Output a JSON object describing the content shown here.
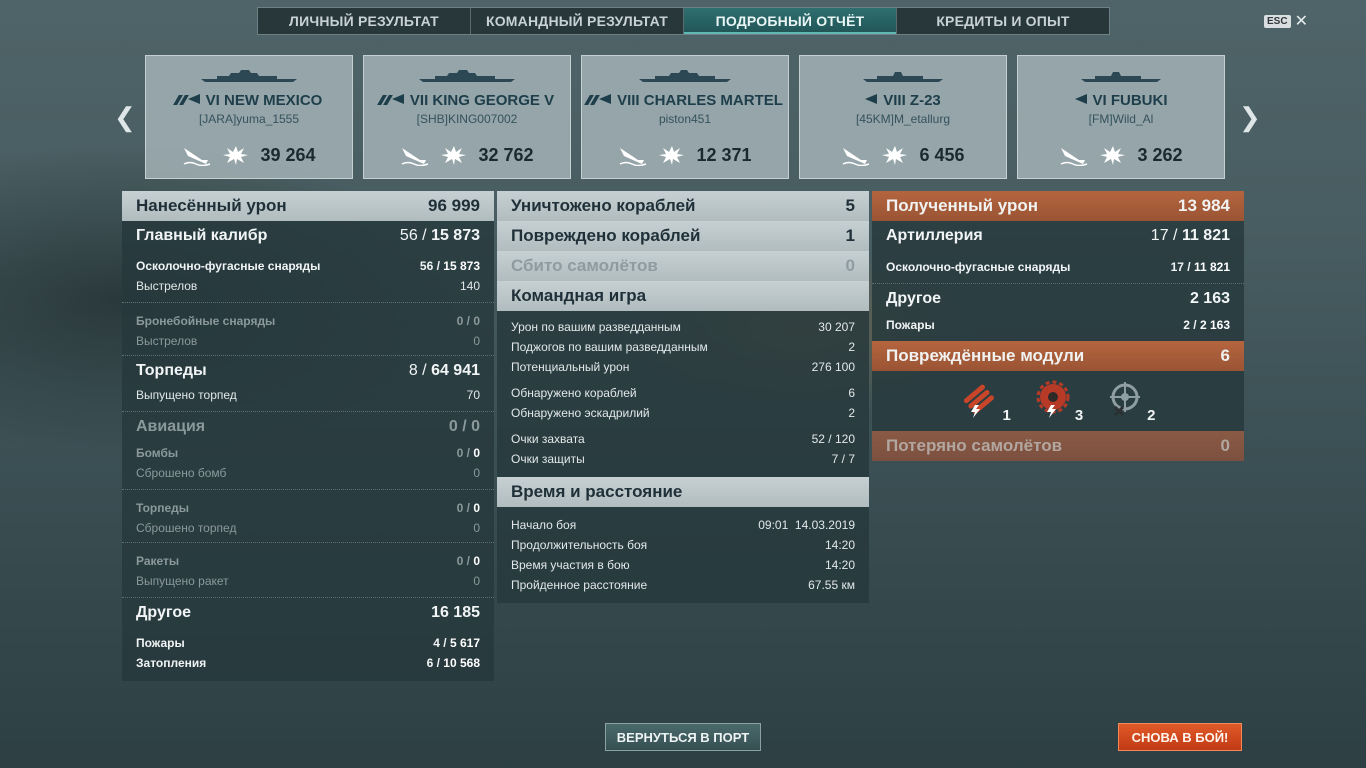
{
  "tabs": [
    "ЛИЧНЫЙ РЕЗУЛЬТАТ",
    "КОМАНДНЫЙ РЕЗУЛЬТАТ",
    "ПОДРОБНЫЙ ОТЧЁТ",
    "КРЕДИТЫ И ОПЫТ"
  ],
  "active_tab": "ПОДРОБНЫЙ ОТЧЁТ",
  "esc_label": "ESC",
  "close_glyph": "✕",
  "arrows": {
    "left": "❮",
    "right": "❯"
  },
  "ships": [
    {
      "tier_name": "VI NEW MEXICO",
      "player": "[JARA]yuma_1555",
      "damage": "39 264",
      "type": "battleship"
    },
    {
      "tier_name": "VII KING GEORGE V",
      "player": "[SHB]KING007002",
      "damage": "32 762",
      "type": "battleship"
    },
    {
      "tier_name": "VIII CHARLES MARTEL",
      "player": "piston451",
      "damage": "12 371",
      "type": "cruiser"
    },
    {
      "tier_name": "VIII Z-23",
      "player": "[45KM]M_etallurg",
      "damage": "6 456",
      "type": "destroyer"
    },
    {
      "tier_name": "VI FUBUKI",
      "player": "[FM]Wild_Al",
      "damage": "3 262",
      "type": "destroyer"
    }
  ],
  "left": {
    "dealt": {
      "label": "Нанесённый урон",
      "value": "96 999"
    },
    "main_battery": {
      "label": "Главный калибр",
      "hits": "56",
      "damage": "15 873"
    },
    "he": {
      "label": "Осколочно-фугасные снаряды",
      "hits": "56",
      "damage": "15 873"
    },
    "he_shots": {
      "label": "Выстрелов",
      "value": "140"
    },
    "ap": {
      "label": "Бронебойные снаряды",
      "value": "0 / 0"
    },
    "ap_shots": {
      "label": "Выстрелов",
      "value": "0"
    },
    "torpedoes": {
      "label": "Торпеды",
      "hits": "8",
      "damage": "64 941"
    },
    "torp_fired": {
      "label": "Выпущено торпед",
      "value": "70"
    },
    "aviation": {
      "label": "Авиация",
      "value": "0 / 0"
    },
    "bombs": {
      "label": "Бомбы",
      "hits": "0",
      "damage": "0"
    },
    "bombs_dropped": {
      "label": "Сброшено бомб",
      "value": "0"
    },
    "air_torps": {
      "label": "Торпеды",
      "hits": "0",
      "damage": "0"
    },
    "air_torps_dropped": {
      "label": "Сброшено торпед",
      "value": "0"
    },
    "rockets": {
      "label": "Ракеты",
      "hits": "0",
      "damage": "0"
    },
    "rockets_fired": {
      "label": "Выпущено ракет",
      "value": "0"
    },
    "other": {
      "label": "Другое",
      "value": "16 185"
    },
    "fires": {
      "label": "Пожары",
      "hits": "4",
      "damage": "5 617"
    },
    "floods": {
      "label": "Затопления",
      "hits": "6",
      "damage": "10 568"
    }
  },
  "middle": {
    "destroyed": {
      "label": "Уничтожено кораблей",
      "value": "5"
    },
    "damaged": {
      "label": "Повреждено кораблей",
      "value": "1"
    },
    "planes": {
      "label": "Сбито самолётов",
      "value": "0"
    },
    "team": {
      "label": "Командная игра"
    },
    "team_rows": [
      {
        "label": "Урон по вашим разведданным",
        "value": "30 207"
      },
      {
        "label": "Поджогов по вашим разведданным",
        "value": "2"
      },
      {
        "label": "Потенциальный урон",
        "value": "276 100"
      },
      {
        "label": "Обнаружено кораблей",
        "value": "6"
      },
      {
        "label": "Обнаружено эскадрилий",
        "value": "2"
      },
      {
        "label": "Очки захвата",
        "value": "52 / 120"
      },
      {
        "label": "Очки защиты",
        "value": "7 / 7"
      }
    ],
    "time": {
      "label": "Время и расстояние"
    },
    "time_rows": [
      {
        "label": "Начало боя",
        "value": "09:01  14.03.2019"
      },
      {
        "label": "Продолжительность боя",
        "value": "14:20"
      },
      {
        "label": "Время участия в бою",
        "value": "14:20"
      },
      {
        "label": "Пройденное расстояние",
        "value": "67.55 км"
      }
    ]
  },
  "right": {
    "received": {
      "label": "Полученный урон",
      "value": "13 984"
    },
    "artillery": {
      "label": "Артиллерия",
      "hits": "17",
      "damage": "11 821"
    },
    "he": {
      "label": "Осколочно-фугасные снаряды",
      "hits": "17",
      "damage": "11 821"
    },
    "other": {
      "label": "Другое",
      "value": "2 163"
    },
    "fires": {
      "label": "Пожары",
      "hits": "2",
      "damage": "2 163"
    },
    "modules": {
      "label": "Повреждённые модули",
      "value": "6"
    },
    "module_counts": [
      {
        "icon": "torpedo-tubes-icon",
        "value": "1"
      },
      {
        "icon": "engine-icon",
        "value": "3"
      },
      {
        "icon": "steering-gear-icon",
        "value": "2"
      }
    ],
    "planes_lost": {
      "label": "Потеряно самолётов",
      "value": "0"
    }
  },
  "buttons": {
    "port": "ВЕРНУТЬСЯ В ПОРТ",
    "battle": "СНОВА В БОЙ!"
  },
  "colors": {
    "accent_tab": "#2f6f70",
    "received_header": "#b4653e",
    "battle_button": "#d04a1e"
  }
}
